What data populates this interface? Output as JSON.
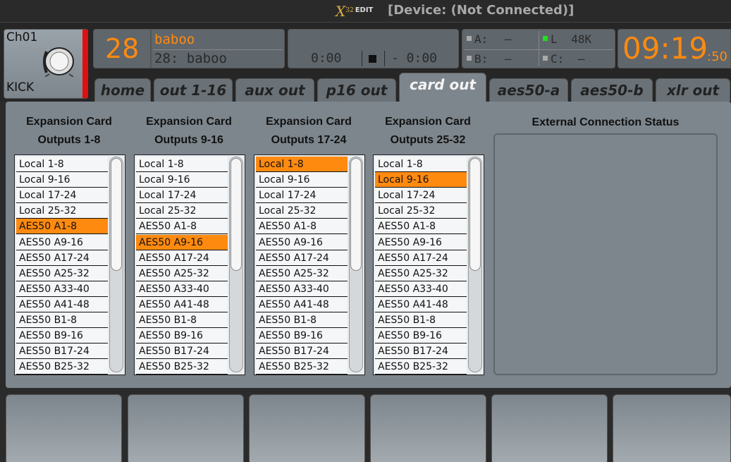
{
  "title": {
    "logo": "X",
    "logo_sup": "32",
    "logo_edit": "EDIT",
    "device": "[Device: (Not Connected)]"
  },
  "channel": {
    "name": "Ch01",
    "label": "KICK",
    "icon": "kick-drum-icon",
    "color": "#e01010"
  },
  "scene": {
    "number": "28",
    "name": "baboo",
    "subtitle": "28: baboo"
  },
  "transport": {
    "elapsed": "0:00",
    "remaining": "- 0:00"
  },
  "bus": {
    "a_label": "A:",
    "a_value": "–",
    "b_label": "B:",
    "b_value": "–",
    "l_label": "L",
    "l_value": "48K",
    "c_label": "C:",
    "c_value": "–"
  },
  "clock": {
    "hm": "09:19",
    "ss": ":50"
  },
  "tabs": [
    {
      "label": "home"
    },
    {
      "label": "out 1-16"
    },
    {
      "label": "aux out"
    },
    {
      "label": "p16 out"
    },
    {
      "label": "card out"
    },
    {
      "label": "aes50-a"
    },
    {
      "label": "aes50-b"
    },
    {
      "label": "xlr out"
    }
  ],
  "columns": [
    {
      "line1": "Expansion Card",
      "line2": "Outputs 1-8",
      "selected": 4
    },
    {
      "line1": "Expansion Card",
      "line2": "Outputs 9-16",
      "selected": 5
    },
    {
      "line1": "Expansion Card",
      "line2": "Outputs 17-24",
      "selected": 0
    },
    {
      "line1": "Expansion Card",
      "line2": "Outputs 25-32",
      "selected": 1
    }
  ],
  "options": [
    "Local 1-8",
    "Local 9-16",
    "Local 17-24",
    "Local 25-32",
    "AES50 A1-8",
    "AES50 A9-16",
    "AES50 A17-24",
    "AES50 A25-32",
    "AES50 A33-40",
    "AES50 A41-48",
    "AES50 B1-8",
    "AES50 B9-16",
    "AES50 B17-24",
    "AES50 B25-32"
  ],
  "external_status": {
    "title": "External Connection Status"
  },
  "colors": {
    "accent": "#ff8a10",
    "panel": "#7d868d",
    "selected": "#ff8a10"
  }
}
